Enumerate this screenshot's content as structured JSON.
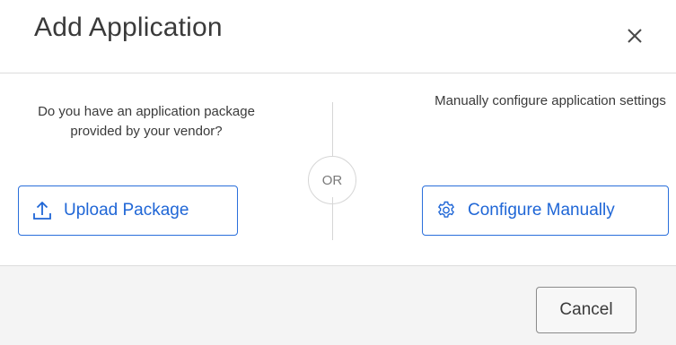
{
  "dialog": {
    "title": "Add Application",
    "close_icon": "close-icon"
  },
  "left": {
    "prompt": "Do you have an application package provided by your vendor?",
    "button_label": "Upload Package",
    "button_icon": "upload-icon"
  },
  "separator": {
    "label": "OR"
  },
  "right": {
    "prompt": "Manually configure application settings",
    "button_label": "Configure Manually",
    "button_icon": "gear-icon"
  },
  "footer": {
    "cancel_label": "Cancel"
  },
  "colors": {
    "accent": "#1f66d6",
    "border": "#dcdcdc",
    "footer_bg": "#f4f4f4"
  }
}
